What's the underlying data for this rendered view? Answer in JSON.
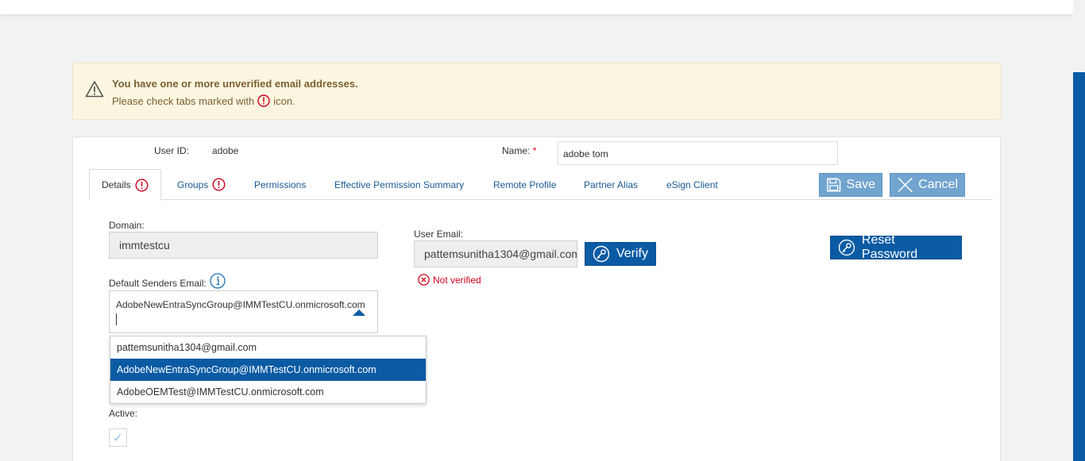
{
  "alert": {
    "title": "You have one or more unverified email addresses.",
    "message_before": "Please check tabs marked with",
    "message_after": "icon."
  },
  "user": {
    "id_label": "User ID:",
    "id_value": "adobe",
    "name_label": "Name:",
    "required_mark": "*",
    "name_value": "adobe tom"
  },
  "tabs": [
    {
      "label": "Details",
      "active": true,
      "error": true
    },
    {
      "label": "Groups",
      "active": false,
      "error": true
    },
    {
      "label": "Permissions",
      "active": false,
      "error": false
    },
    {
      "label": "Effective Permission Summary",
      "active": false,
      "error": false
    },
    {
      "label": "Remote Profile",
      "active": false,
      "error": false
    },
    {
      "label": "Partner Alias",
      "active": false,
      "error": false
    },
    {
      "label": "eSign Client",
      "active": false,
      "error": false
    }
  ],
  "actions": {
    "save_label": "Save",
    "cancel_label": "Cancel",
    "verify_label": "Verify",
    "reset_label": "Reset Password"
  },
  "details": {
    "domain_label": "Domain:",
    "domain_value": "immtestcu",
    "user_email_label": "User Email:",
    "user_email_value": "pattemsunitha1304@gmail.com",
    "not_verified": "Not verified",
    "default_senders_label": "Default Senders Email:",
    "default_senders_value": "AdobeNewEntraSyncGroup@IMMTestCU.onmicrosoft.com",
    "default_senders_options": [
      "pattemsunitha1304@gmail.com",
      "AdobeNewEntraSyncGroup@IMMTestCU.onmicrosoft.com",
      "AdobeOEMTest@IMMTestCU.onmicrosoft.com"
    ],
    "active_label": "Active:",
    "active_checked": true
  },
  "colors": {
    "primary": "#0a5ba4",
    "primary_light": "#71a4cf",
    "error": "#d0021b",
    "alert_bg": "#fcf6e1",
    "alert_text": "#7a6132"
  },
  "icons": {
    "warning": "warning-icon",
    "error": "exclamation-circle-icon",
    "info": "info-icon",
    "save": "floppy-disk-icon",
    "cancel": "close-icon",
    "key": "key-icon",
    "check": "checkmark-icon",
    "not_verified": "x-circle-icon"
  }
}
